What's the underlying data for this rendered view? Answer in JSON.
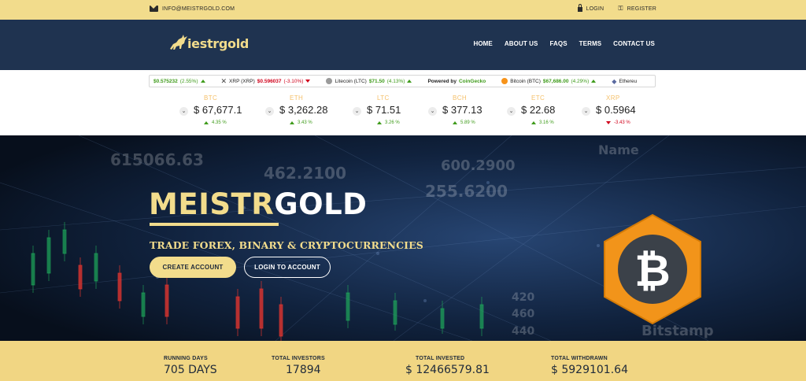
{
  "topbar": {
    "email": "INFO@MEISTRGOLD.COM",
    "login": "LOGIN",
    "register": "REGISTER"
  },
  "brand": {
    "logo_text": "iestrgold",
    "accent": "#f2dc8c",
    "navy": "#1f3350"
  },
  "nav": [
    "HOME",
    "ABOUT US",
    "FAQS",
    "TERMS",
    "CONTACT US"
  ],
  "ticker": {
    "items": [
      {
        "name": "",
        "price": "$0.575232",
        "change": "(2.55%)",
        "dir": "up",
        "icon": ""
      },
      {
        "name": "XRP (XRP)",
        "price": "$0.596037",
        "change": "(-3.10%)",
        "dir": "down",
        "icon": "xrp-icon"
      },
      {
        "name": "Litecoin (LTC)",
        "price": "$71.50",
        "change": "(4.13%)",
        "dir": "up",
        "icon": "litecoin-icon"
      },
      {
        "name": "Bitcoin (BTC)",
        "price": "$67,686.00",
        "change": "(4.29%)",
        "dir": "up",
        "icon": "bitcoin-icon"
      },
      {
        "name": "Ethereu",
        "price": "",
        "change": "",
        "dir": "",
        "icon": "ethereum-icon"
      }
    ],
    "powered_prefix": "Powered by",
    "powered_by": "CoinGecko"
  },
  "prices": [
    {
      "symbol": "BTC",
      "price": "$ 67,677.1",
      "change": "4.35 %",
      "dir": "up"
    },
    {
      "symbol": "ETH",
      "price": "$ 3,262.28",
      "change": "3.43 %",
      "dir": "up"
    },
    {
      "symbol": "LTC",
      "price": "$ 71.51",
      "change": "3.26 %",
      "dir": "up"
    },
    {
      "symbol": "BCH",
      "price": "$ 377.13",
      "change": "5.89 %",
      "dir": "up"
    },
    {
      "symbol": "ETC",
      "price": "$ 22.68",
      "change": "3.16 %",
      "dir": "up"
    },
    {
      "symbol": "XRP",
      "price": "$ 0.5964",
      "change": "-3.43 %",
      "dir": "down"
    }
  ],
  "hero": {
    "title_part1": "MEISTR",
    "title_part2": "GOLD",
    "subtitle": "TRADE FOREX, BINARY & CRYPTOCURRENCIES",
    "create_account": "CREATE ACCOUNT",
    "login_account": "LOGIN TO ACCOUNT",
    "bg_numbers": [
      "615066.63",
      "462.2100",
      "255.6200",
      "600.2900",
      "460",
      "440",
      "420",
      "Name",
      "Bitstamp"
    ]
  },
  "stats": [
    {
      "label": "RUNNING DAYS",
      "value": "705 DAYS"
    },
    {
      "label": "TOTAL INVESTORS",
      "value": "17894"
    },
    {
      "label": "TOTAL INVESTED",
      "value": "$ 12466579.81"
    },
    {
      "label": "TOTAL WITHDRAWN",
      "value": "$ 5929101.64"
    }
  ]
}
